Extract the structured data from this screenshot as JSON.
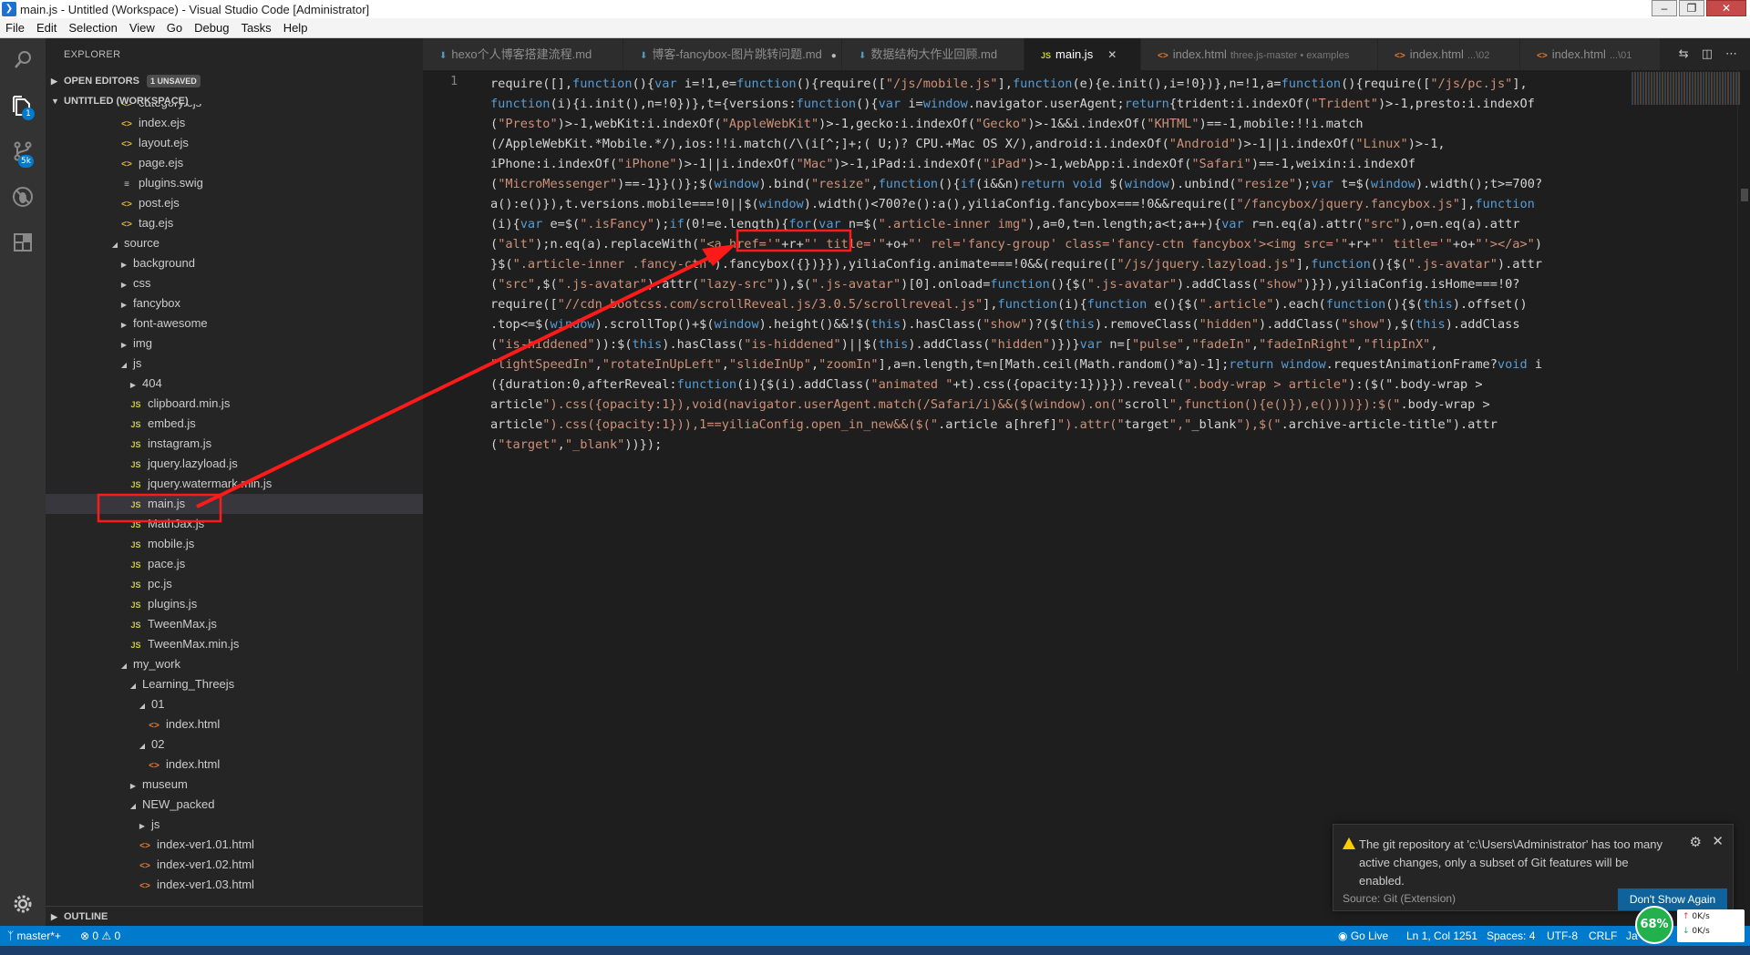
{
  "window": {
    "title": "main.js - Untitled (Workspace) - Visual Studio Code [Administrator]"
  },
  "menu": [
    "File",
    "Edit",
    "Selection",
    "View",
    "Go",
    "Debug",
    "Tasks",
    "Help"
  ],
  "activity": {
    "icons": [
      "files-icon",
      "search-icon",
      "source-control-icon",
      "debug-icon",
      "extensions-icon",
      "settings-gear-icon"
    ],
    "explorer_badge": "1",
    "scm_badge": "5k"
  },
  "sidebar": {
    "title": "EXPLORER",
    "open_editors": "OPEN EDITORS",
    "unsaved": "1 UNSAVED",
    "workspace": "UNTITLED (WORKSPACE)",
    "outline": "OUTLINE",
    "tree": [
      {
        "label": "category.ejs",
        "depth": 3,
        "kind": "ejs"
      },
      {
        "label": "index.ejs",
        "depth": 3,
        "kind": "ejs"
      },
      {
        "label": "layout.ejs",
        "depth": 3,
        "kind": "ejs"
      },
      {
        "label": "page.ejs",
        "depth": 3,
        "kind": "ejs"
      },
      {
        "label": "plugins.swig",
        "depth": 3,
        "kind": "swig"
      },
      {
        "label": "post.ejs",
        "depth": 3,
        "kind": "ejs"
      },
      {
        "label": "tag.ejs",
        "depth": 3,
        "kind": "ejs"
      },
      {
        "label": "source",
        "depth": 2,
        "kind": "folder-open"
      },
      {
        "label": "background",
        "depth": 3,
        "kind": "folder"
      },
      {
        "label": "css",
        "depth": 3,
        "kind": "folder"
      },
      {
        "label": "fancybox",
        "depth": 3,
        "kind": "folder"
      },
      {
        "label": "font-awesome",
        "depth": 3,
        "kind": "folder"
      },
      {
        "label": "img",
        "depth": 3,
        "kind": "folder"
      },
      {
        "label": "js",
        "depth": 3,
        "kind": "folder-open"
      },
      {
        "label": "404",
        "depth": 4,
        "kind": "folder"
      },
      {
        "label": "clipboard.min.js",
        "depth": 4,
        "kind": "js"
      },
      {
        "label": "embed.js",
        "depth": 4,
        "kind": "js"
      },
      {
        "label": "instagram.js",
        "depth": 4,
        "kind": "js"
      },
      {
        "label": "jquery.lazyload.js",
        "depth": 4,
        "kind": "js"
      },
      {
        "label": "jquery.watermark.min.js",
        "depth": 4,
        "kind": "js"
      },
      {
        "label": "main.js",
        "depth": 4,
        "kind": "js",
        "selected": true
      },
      {
        "label": "MathJax.js",
        "depth": 4,
        "kind": "js"
      },
      {
        "label": "mobile.js",
        "depth": 4,
        "kind": "js"
      },
      {
        "label": "pace.js",
        "depth": 4,
        "kind": "js"
      },
      {
        "label": "pc.js",
        "depth": 4,
        "kind": "js"
      },
      {
        "label": "plugins.js",
        "depth": 4,
        "kind": "js"
      },
      {
        "label": "TweenMax.js",
        "depth": 4,
        "kind": "js"
      },
      {
        "label": "TweenMax.min.js",
        "depth": 4,
        "kind": "js"
      },
      {
        "label": "my_work",
        "depth": 3,
        "kind": "folder-open"
      },
      {
        "label": "Learning_Threejs",
        "depth": 4,
        "kind": "folder-open"
      },
      {
        "label": "01",
        "depth": 5,
        "kind": "folder-open"
      },
      {
        "label": "index.html",
        "depth": 6,
        "kind": "html"
      },
      {
        "label": "02",
        "depth": 5,
        "kind": "folder-open"
      },
      {
        "label": "index.html",
        "depth": 6,
        "kind": "html"
      },
      {
        "label": "museum",
        "depth": 4,
        "kind": "folder"
      },
      {
        "label": "NEW_packed",
        "depth": 4,
        "kind": "folder-open"
      },
      {
        "label": "js",
        "depth": 5,
        "kind": "folder"
      },
      {
        "label": "index-ver1.01.html",
        "depth": 5,
        "kind": "html"
      },
      {
        "label": "index-ver1.02.html",
        "depth": 5,
        "kind": "html"
      },
      {
        "label": "index-ver1.03.html",
        "depth": 5,
        "kind": "html"
      }
    ]
  },
  "tabs": [
    {
      "label": "hexo个人博客搭建流程.md",
      "icon": "md",
      "desc": ""
    },
    {
      "label": "博客-fancybox-图片跳转问题.md",
      "icon": "md",
      "desc": "",
      "dirty": true
    },
    {
      "label": "数据结构大作业回顾.md",
      "icon": "md",
      "desc": ""
    },
    {
      "label": "main.js",
      "icon": "js",
      "desc": "",
      "active": true
    },
    {
      "label": "index.html",
      "icon": "html",
      "desc": "three.js-master • examples"
    },
    {
      "label": "index.html",
      "icon": "html",
      "desc": "...\\02"
    },
    {
      "label": "index.html",
      "icon": "html",
      "desc": "...\\01"
    }
  ],
  "editor": {
    "line_number": "1",
    "code_lines": [
      "require([],function(){var i=!1,e=function(){require([\"/js/mobile.js\"],function(e){e.init(),i=!0})},n=!1,a=function(){require([\"/js/pc.js\"],",
      "function(i){i.init(),n=!0})},t={versions:function(){var i=window.navigator.userAgent;return{trident:i.indexOf(\"Trident\")>-1,presto:i.indexOf",
      "(\"Presto\")>-1,webKit:i.indexOf(\"AppleWebKit\")>-1,gecko:i.indexOf(\"Gecko\")>-1&&i.indexOf(\"KHTML\")==-1,mobile:!!i.match",
      "(/AppleWebKit.*Mobile.*/),ios:!!i.match(/\\(i[^;]+;( U;)? CPU.+Mac OS X/),android:i.indexOf(\"Android\")>-1||i.indexOf(\"Linux\")>-1,",
      "iPhone:i.indexOf(\"iPhone\")>-1||i.indexOf(\"Mac\")>-1,iPad:i.indexOf(\"iPad\")>-1,webApp:i.indexOf(\"Safari\")==-1,weixin:i.indexOf",
      "(\"MicroMessenger\")==-1}}()};$(window).bind(\"resize\",function(){if(i&&n)return void $(window).unbind(\"resize\");var t=$(window).width();t>=700?",
      "a():e()}),t.versions.mobile===!0||$(window).width()<700?e():a(),yiliaConfig.fancybox===!0&&require([\"/fancybox/jquery.fancybox.js\"],function",
      "(i){var e=$(\".isFancy\");if(0!=e.length){for(var n=$(\".article-inner img\"),a=0,t=n.length;a<t;a++){var r=n.eq(a).attr(\"src\"),o=n.eq(a).attr",
      "(\"alt\");n.eq(a).replaceWith(\"<a href='\"+r+\"' title='\"+o+\"' rel='fancy-group' class='fancy-ctn fancybox'><img src='\"+r+\"' title='\"+o+\"'></a>\")",
      "}$(\".article-inner .fancy-ctn\").fancybox({})}}),yiliaConfig.animate===!0&&(require([\"/js/jquery.lazyload.js\"],function(){$(\".js-avatar\").attr",
      "(\"src\",$(\".js-avatar\").attr(\"lazy-src\")),$(\".js-avatar\")[0].onload=function(){$(\".js-avatar\").addClass(\"show\")}}),yiliaConfig.isHome===!0?",
      "require([\"//cdn.bootcss.com/scrollReveal.js/3.0.5/scrollreveal.js\"],function(i){function e(){$(\".article\").each(function(){$(this).offset()",
      ".top<=$(window).scrollTop()+$(window).height()&&!$(this).hasClass(\"show\")?($(this).removeClass(\"hidden\").addClass(\"show\"),$(this).addClass",
      "(\"is-hiddened\")):$(this).hasClass(\"is-hiddened\")||$(this).addClass(\"hidden\")})}var n=[\"pulse\",\"fadeIn\",\"fadeInRight\",\"flipInX\",",
      "\"lightSpeedIn\",\"rotateInUpLeft\",\"slideInUp\",\"zoomIn\"],a=n.length,t=n[Math.ceil(Math.random()*a)-1];return window.requestAnimationFrame?void i",
      "({duration:0,afterReveal:function(i){$(i).addClass(\"animated \"+t).css({opacity:1})}}).reveal(\".body-wrap > article\"):($(\".body-wrap >",
      "article\").css({opacity:1}),void(navigator.userAgent.match(/Safari/i)&&($(window).on(\"scroll\",function(){e()}),e())))}):$(\".body-wrap >",
      "article\").css({opacity:1})),1==yiliaConfig.open_in_new&&($(\".article a[href]\").attr(\"target\",\"_blank\"),$(\".archive-article-title\").attr",
      "(\"target\",\"_blank\"))});"
    ]
  },
  "notification": {
    "message": "The git repository at 'c:\\Users\\Administrator' has too many active changes, only a subset of Git features will be enabled.",
    "source": "Source: Git (Extension)",
    "button": "Don't Show Again"
  },
  "statusbar": {
    "branch": "master*+",
    "errors": "0",
    "warnings": "0",
    "go_live": "Go Live",
    "position": "Ln 1, Col 1251",
    "spaces": "Spaces: 4",
    "encoding": "UTF-8",
    "eol": "CRLF",
    "language": "Ja"
  },
  "network": {
    "percent": "68%",
    "up": "0K/s",
    "down": "0K/s"
  },
  "colors": {
    "accent": "#007acc",
    "annotation": "#ff1a1a"
  }
}
